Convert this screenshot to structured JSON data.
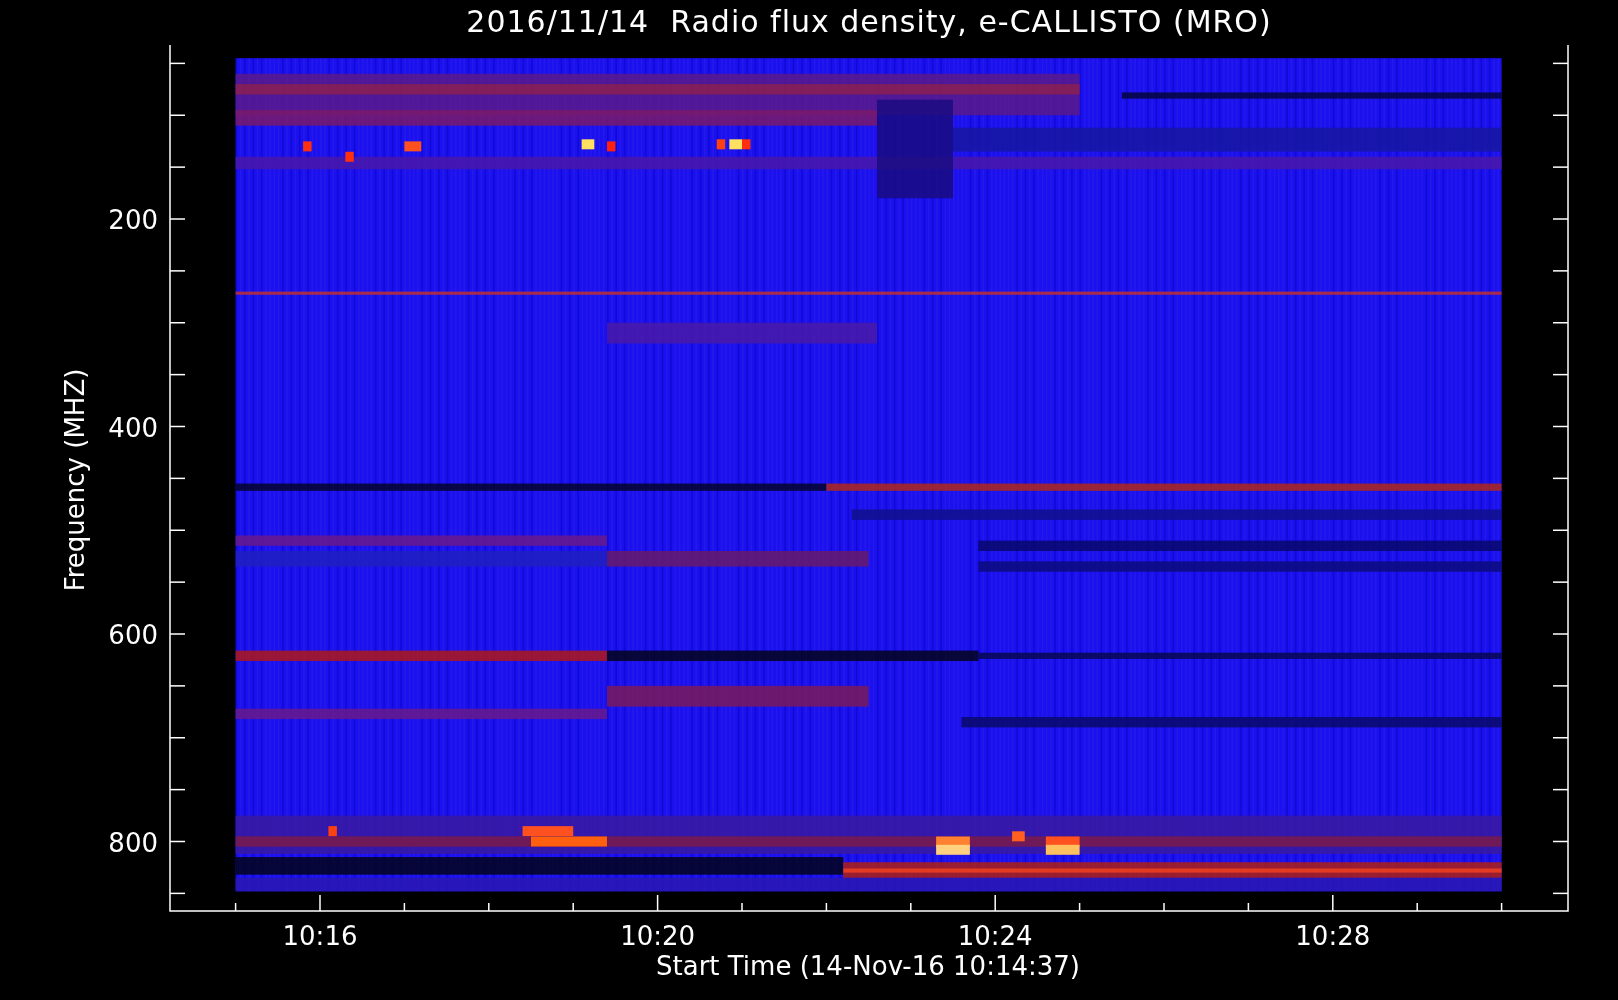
{
  "title": "2016/11/14  Radio flux density, e-CALLISTO (MRO)",
  "plot": {
    "ylabel": "Frequency (MHZ)",
    "xlabel": "Start Time (14-Nov-16 10:14:37)",
    "yticks": [
      {
        "label": "200"
      },
      {
        "label": "400"
      },
      {
        "label": "600"
      },
      {
        "label": "800"
      }
    ],
    "xticks": [
      {
        "label": "10:16"
      },
      {
        "label": "10:20"
      },
      {
        "label": "10:24"
      },
      {
        "label": "10:28"
      }
    ]
  }
}
